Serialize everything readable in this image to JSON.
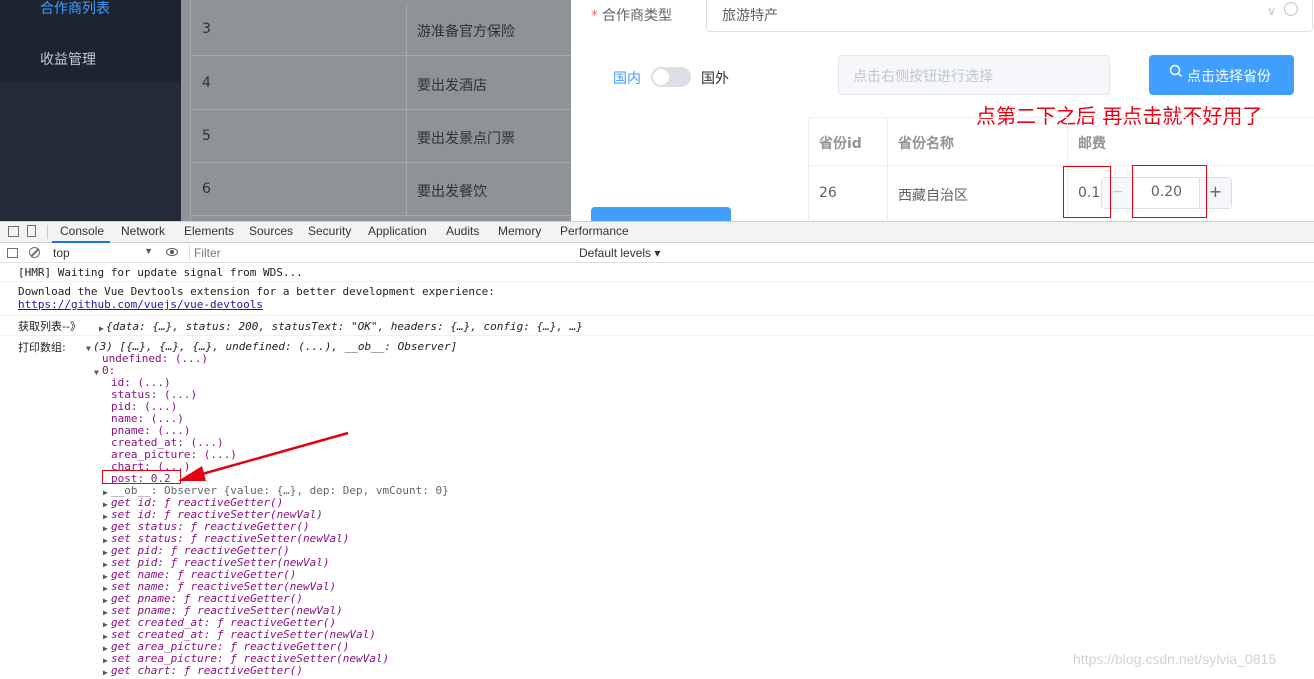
{
  "sidebar": {
    "items": [
      {
        "label": "合作商列表"
      },
      {
        "label": "收益管理"
      }
    ]
  },
  "list": {
    "rows": [
      {
        "num": "3",
        "name": "游准备官方保险"
      },
      {
        "num": "4",
        "name": "要出发酒店"
      },
      {
        "num": "5",
        "name": "要出发景点门票"
      },
      {
        "num": "6",
        "name": "要出发餐饮"
      }
    ]
  },
  "form": {
    "type_label": "合作商类型",
    "required_mark": "*",
    "type_value": "旅游特产",
    "switch": {
      "domestic": "国内",
      "foreign": "国外",
      "on": false
    },
    "province_placeholder": "点击右侧按钮进行选择",
    "province_button": "点击选择省份",
    "table": {
      "headers": [
        "省份id",
        "省份名称",
        "邮费"
      ],
      "rows": [
        {
          "id": "26",
          "name": "西藏自治区",
          "post_text": "0.1",
          "post_value": "0.20"
        }
      ]
    }
  },
  "annotation": {
    "text": "点第二下之后  再点击就不好用了",
    "color": "#e60012"
  },
  "devtools": {
    "tabs": [
      "Console",
      "Network",
      "Elements",
      "Sources",
      "Security",
      "Application",
      "Audits",
      "Memory",
      "Performance"
    ],
    "active_tab": "Console",
    "context": "top",
    "filter_placeholder": "Filter",
    "levels": "Default levels"
  },
  "console": {
    "hmr": "[HMR] Waiting for update signal from WDS...",
    "devtools_line1": "Download the Vue Devtools extension for a better development experience:",
    "devtools_link": "https://github.com/vuejs/vue-devtools",
    "fetch_label": "获取列表--》",
    "fetch_obj": "{data: {…}, status: 200, statusText: \"OK\", headers: {…}, config: {…}, …}",
    "print_label": "打印数组:",
    "array_summary": "(3) [{…}, {…}, {…}, undefined: (...), __ob__: Observer]",
    "undefined_line": "undefined: (...)",
    "index_line": "0:",
    "props": [
      "id: (...)",
      "status: (...)",
      "pid: (...)",
      "name: (...)",
      "pname: (...)",
      "created_at: (...)",
      "area_picture: (...)",
      "chart: (...)"
    ],
    "post_line": "post: 0.2",
    "ob_line": "__ob__: Observer {value: {…}, dep: Dep, vmCount: 0}",
    "accessors": [
      "get id: ƒ reactiveGetter()",
      "set id: ƒ reactiveSetter(newVal)",
      "get status: ƒ reactiveGetter()",
      "set status: ƒ reactiveSetter(newVal)",
      "get pid: ƒ reactiveGetter()",
      "set pid: ƒ reactiveSetter(newVal)",
      "get name: ƒ reactiveGetter()",
      "set name: ƒ reactiveSetter(newVal)",
      "get pname: ƒ reactiveGetter()",
      "set pname: ƒ reactiveSetter(newVal)",
      "get created_at: ƒ reactiveGetter()",
      "set created_at: ƒ reactiveSetter(newVal)",
      "get area_picture: ƒ reactiveGetter()",
      "set area_picture: ƒ reactiveSetter(newVal)",
      "get chart: ƒ reactiveGetter()"
    ]
  },
  "watermark": "https://blog.csdn.net/sylvia_0815"
}
